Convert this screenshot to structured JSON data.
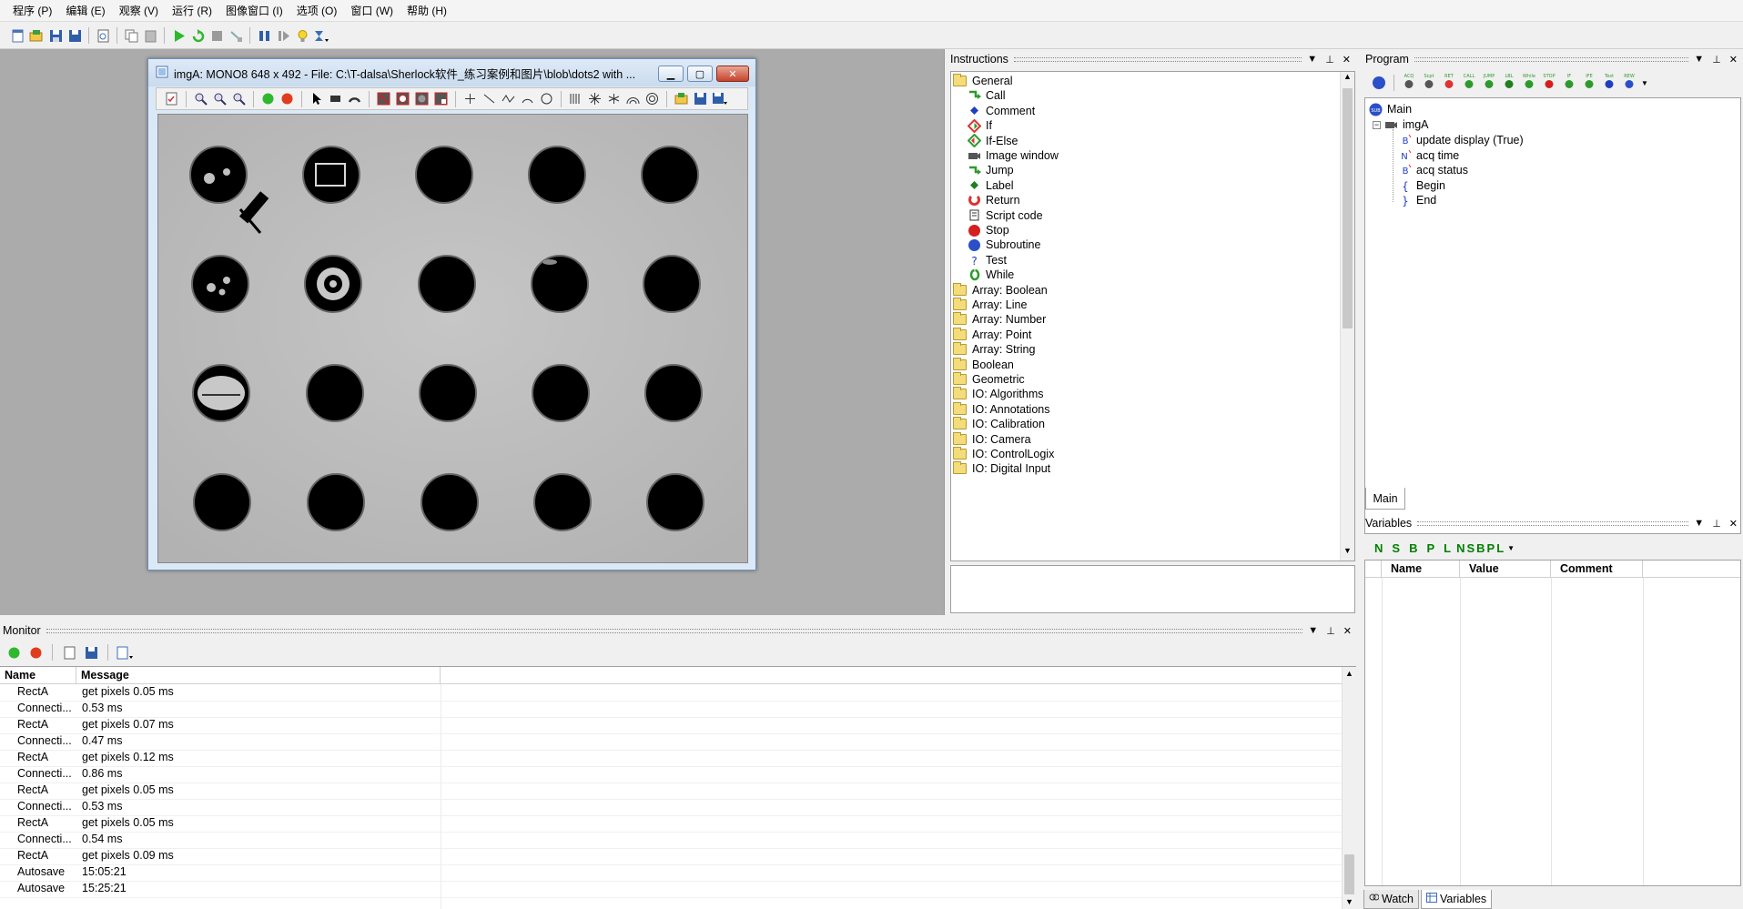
{
  "menu": [
    "程序 (P)",
    "编辑 (E)",
    "观察 (V)",
    "运行 (R)",
    "图像窗口 (I)",
    "选项 (O)",
    "窗口 (W)",
    "帮助 (H)"
  ],
  "image_window": {
    "title": "imgA: MONO8 648 x 492 - File: C:\\T-dalsa\\Sherlock软件_练习案例和图片\\blob\\dots2 with ..."
  },
  "instructions": {
    "title": "Instructions",
    "general_label": "General",
    "general_items": [
      "Call",
      "Comment",
      "If",
      "If-Else",
      "Image window",
      "Jump",
      "Label",
      "Return",
      "Script code",
      "Stop",
      "Subroutine",
      "Test",
      "While"
    ],
    "folders": [
      "Array: Boolean",
      "Array: Line",
      "Array: Number",
      "Array: Point",
      "Array: String",
      "Boolean",
      "Geometric",
      "IO: Algorithms",
      "IO: Annotations",
      "IO: Calibration",
      "IO: Camera",
      "IO: ControlLogix",
      "IO: Digital Input"
    ]
  },
  "program": {
    "title": "Program",
    "toolbar_labels": [
      "ACQ",
      "Scpt",
      "RET",
      "CALL",
      "JUMP",
      "LBL",
      "While",
      "STOP",
      "IF",
      "IFE",
      "Test",
      "REW"
    ],
    "main": "Main",
    "imgA": "imgA",
    "children": [
      "update display (True)",
      "acq time",
      "acq status",
      "Begin",
      "End"
    ],
    "tab": "Main"
  },
  "variables": {
    "title": "Variables",
    "toolbar": [
      "N",
      "S",
      "B",
      "P",
      "L",
      "N",
      "S",
      "B",
      "P",
      "L"
    ],
    "columns": [
      "Name",
      "Value",
      "Comment"
    ]
  },
  "bottom_tabs": [
    "Watch",
    "Variables"
  ],
  "monitor": {
    "title": "Monitor",
    "columns": [
      "Name",
      "Message"
    ],
    "rows": [
      {
        "name": "RectA",
        "message": "get pixels 0.05 ms"
      },
      {
        "name": "Connecti...",
        "message": "0.53 ms"
      },
      {
        "name": "RectA",
        "message": "get pixels 0.07 ms"
      },
      {
        "name": "Connecti...",
        "message": "0.47 ms"
      },
      {
        "name": "RectA",
        "message": "get pixels 0.12 ms"
      },
      {
        "name": "Connecti...",
        "message": "0.86 ms"
      },
      {
        "name": "RectA",
        "message": "get pixels 0.05 ms"
      },
      {
        "name": "Connecti...",
        "message": "0.53 ms"
      },
      {
        "name": "RectA",
        "message": "get pixels 0.05 ms"
      },
      {
        "name": "Connecti...",
        "message": "0.54 ms"
      },
      {
        "name": "RectA",
        "message": "get pixels 0.09 ms"
      },
      {
        "name": "Autosave",
        "message": "15:05:21"
      },
      {
        "name": "Autosave",
        "message": "15:25:21"
      }
    ]
  },
  "colors": {
    "workspace": "#ababab",
    "run_green": "#2eb82e",
    "stop_red": "#e03c1e",
    "program_blue": "#2a4fc9"
  }
}
